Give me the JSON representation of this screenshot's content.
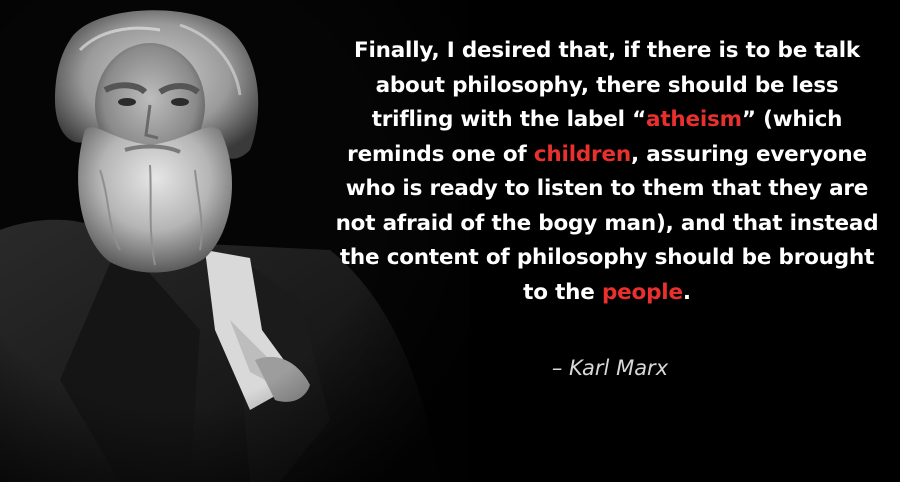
{
  "colors": {
    "background": "#000000",
    "text": "#ffffff",
    "highlight": "#e8302f",
    "attribution": "#d8d8d8"
  },
  "quote": {
    "line1": "Finally, I desired that, if there is to be talk",
    "line2": "about philosophy, there should be less",
    "line3_pre": "trifling with the  label  “",
    "line3_hl": "atheism",
    "line3_post": "” (which",
    "line4_pre": "reminds one of ",
    "line4_hl": "children",
    "line4_post": ", assuring everyone",
    "line5": "who is ready to listen to them that they are",
    "line6": "not afraid of the bogy man), and that instead",
    "line7": "the content of philosophy should be brought",
    "line8_pre": "to the ",
    "line8_hl": "people",
    "line8_post": "."
  },
  "attribution": "–  Karl Marx"
}
